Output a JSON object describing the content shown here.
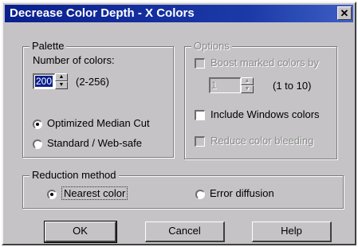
{
  "window": {
    "title": "Decrease Color Depth - X Colors",
    "close_glyph": "✕"
  },
  "palette": {
    "legend": "Palette",
    "num_colors_label": "Number of colors:",
    "num_colors_value": "200",
    "range_hint": "(2-256)",
    "options": [
      {
        "label": "Optimized Median Cut",
        "selected": true
      },
      {
        "label": "Standard / Web-safe",
        "selected": false
      }
    ]
  },
  "options_group": {
    "legend": "Options",
    "boost_label": "Boost marked colors by",
    "boost_value": "1",
    "boost_range": "(1 to 10)",
    "include_windows_label": "Include Windows colors",
    "reduce_bleeding_label": "Reduce color bleeding"
  },
  "reduction": {
    "legend": "Reduction method",
    "options": [
      {
        "label": "Nearest color",
        "selected": true
      },
      {
        "label": "Error diffusion",
        "selected": false
      }
    ]
  },
  "buttons": {
    "ok": "OK",
    "cancel": "Cancel",
    "help": "Help"
  }
}
